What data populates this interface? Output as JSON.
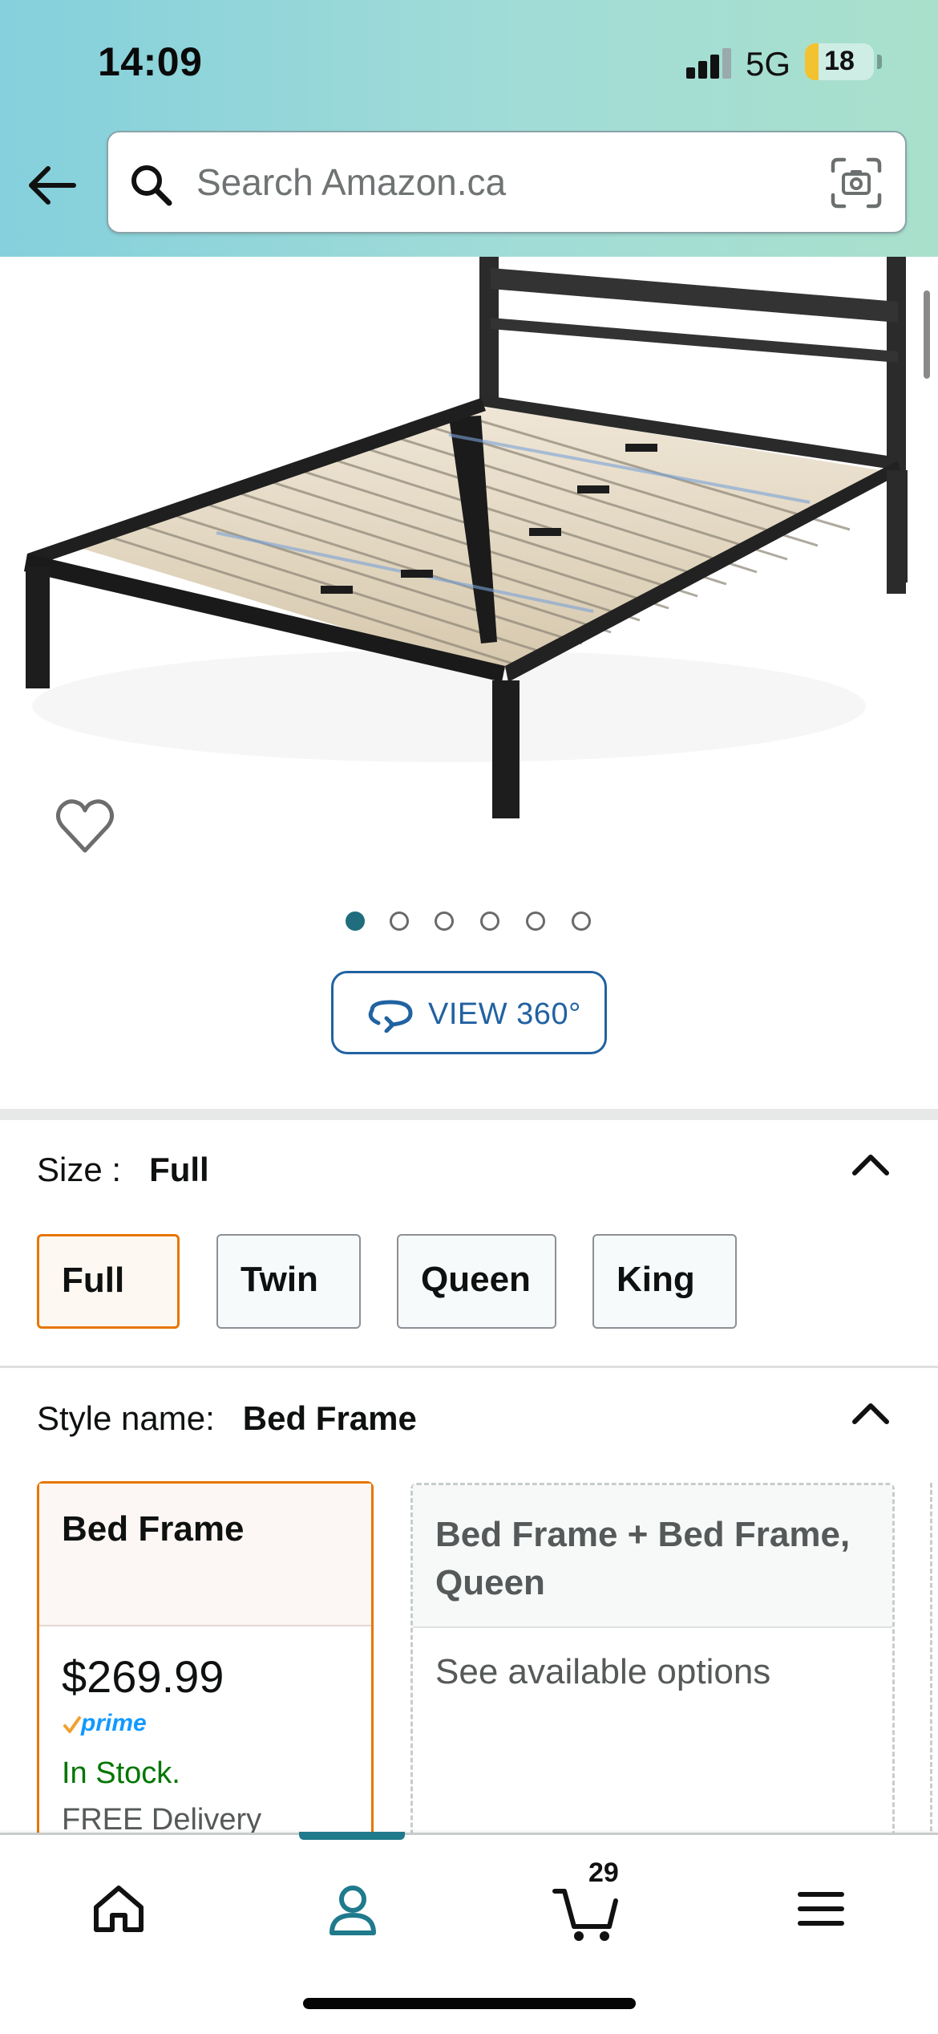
{
  "status_bar": {
    "time": "14:09",
    "network": "5G",
    "battery": "18"
  },
  "header": {
    "back_icon": "arrow-left-icon",
    "search_placeholder": "Search Amazon.ca",
    "search_value": "",
    "camera_icon": "camera-scan-icon"
  },
  "gallery": {
    "image_count": 6,
    "active_index": 0,
    "view360_label": "VIEW 360°"
  },
  "size": {
    "label": "Size :",
    "selected": "Full",
    "options": [
      "Full",
      "Twin",
      "Queen",
      "King"
    ]
  },
  "style": {
    "label": "Style name:",
    "selected": "Bed Frame",
    "cards": [
      {
        "title": "Bed Frame",
        "price": "$269.99",
        "badge": "prime",
        "stock": "In Stock.",
        "delivery": "FREE Delivery"
      },
      {
        "title": "Bed Frame + Bed Frame, Queen",
        "note": "See available options"
      }
    ]
  },
  "bottom_nav": {
    "items": [
      "home-icon",
      "account-icon",
      "cart-icon",
      "menu-icon"
    ],
    "active": "account-icon",
    "cart_count": "29"
  },
  "colors": {
    "header_gradient_start": "#84d0dc",
    "header_gradient_end": "#a9e0cc",
    "accent_teal": "#1f6d7d",
    "link_blue": "#2162a1",
    "selected_orange": "#e77600",
    "in_stock_green": "#007600",
    "prime_blue": "#1399ff"
  }
}
